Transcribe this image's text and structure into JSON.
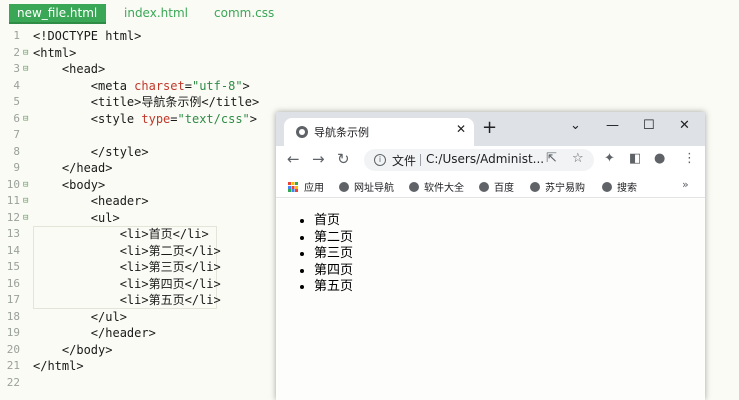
{
  "editor": {
    "tabs": [
      {
        "label": "new_file.html",
        "active": true
      },
      {
        "label": "index.html",
        "active": false
      },
      {
        "label": "comm.css",
        "active": false
      }
    ],
    "accent_color": "#3aa757",
    "lines": [
      {
        "num": "1",
        "fold": "",
        "indent": "",
        "parts": [
          [
            "tag",
            "<!DOCTYPE html>"
          ]
        ]
      },
      {
        "num": "2",
        "fold": "⊟",
        "indent": "",
        "parts": [
          [
            "tag",
            "<html>"
          ]
        ]
      },
      {
        "num": "3",
        "fold": "⊟",
        "indent": "    ",
        "parts": [
          [
            "tag",
            "<head>"
          ]
        ]
      },
      {
        "num": "4",
        "fold": "",
        "indent": "        ",
        "parts": [
          [
            "tag",
            "<meta "
          ],
          [
            "attr",
            "charset"
          ],
          [
            "tag",
            "="
          ],
          [
            "str",
            "\"utf-8\""
          ],
          [
            "tag",
            ">"
          ]
        ]
      },
      {
        "num": "5",
        "fold": "",
        "indent": "        ",
        "parts": [
          [
            "tag",
            "<title>"
          ],
          [
            "plain",
            "导航条示例"
          ],
          [
            "tag",
            "</title>"
          ]
        ]
      },
      {
        "num": "6",
        "fold": "⊟",
        "indent": "        ",
        "parts": [
          [
            "tag",
            "<style "
          ],
          [
            "attr",
            "type"
          ],
          [
            "tag",
            "="
          ],
          [
            "str",
            "\"text/css\""
          ],
          [
            "tag",
            ">"
          ]
        ]
      },
      {
        "num": "7",
        "fold": "",
        "indent": "",
        "parts": []
      },
      {
        "num": "8",
        "fold": "",
        "indent": "        ",
        "parts": [
          [
            "tag",
            "</style>"
          ]
        ]
      },
      {
        "num": "9",
        "fold": "",
        "indent": "    ",
        "parts": [
          [
            "tag",
            "</head>"
          ]
        ]
      },
      {
        "num": "10",
        "fold": "⊟",
        "indent": "    ",
        "parts": [
          [
            "tag",
            "<body>"
          ]
        ]
      },
      {
        "num": "11",
        "fold": "⊟",
        "indent": "        ",
        "parts": [
          [
            "tag",
            "<header>"
          ]
        ]
      },
      {
        "num": "12",
        "fold": "⊟",
        "indent": "        ",
        "parts": [
          [
            "tag",
            "<ul>"
          ]
        ]
      },
      {
        "num": "13",
        "fold": "",
        "indent": "            ",
        "parts": [
          [
            "tag",
            "<li>"
          ],
          [
            "plain",
            "首页"
          ],
          [
            "tag",
            "</li>"
          ]
        ]
      },
      {
        "num": "14",
        "fold": "",
        "indent": "            ",
        "parts": [
          [
            "tag",
            "<li>"
          ],
          [
            "plain",
            "第二页"
          ],
          [
            "tag",
            "</li>"
          ]
        ]
      },
      {
        "num": "15",
        "fold": "",
        "indent": "            ",
        "parts": [
          [
            "tag",
            "<li>"
          ],
          [
            "plain",
            "第三页"
          ],
          [
            "tag",
            "</li>"
          ]
        ]
      },
      {
        "num": "16",
        "fold": "",
        "indent": "            ",
        "parts": [
          [
            "tag",
            "<li>"
          ],
          [
            "plain",
            "第四页"
          ],
          [
            "tag",
            "</li>"
          ]
        ]
      },
      {
        "num": "17",
        "fold": "",
        "indent": "            ",
        "parts": [
          [
            "tag",
            "<li>"
          ],
          [
            "plain",
            "第五页"
          ],
          [
            "tag",
            "</li>"
          ]
        ]
      },
      {
        "num": "18",
        "fold": "",
        "indent": "        ",
        "parts": [
          [
            "tag",
            "</ul>"
          ]
        ]
      },
      {
        "num": "19",
        "fold": "",
        "indent": "        ",
        "parts": [
          [
            "tag",
            "</header>"
          ]
        ]
      },
      {
        "num": "20",
        "fold": "",
        "indent": "    ",
        "parts": [
          [
            "tag",
            "</body>"
          ]
        ]
      },
      {
        "num": "21",
        "fold": "",
        "indent": "",
        "parts": [
          [
            "tag",
            "</html>"
          ]
        ]
      },
      {
        "num": "22",
        "fold": "",
        "indent": "",
        "parts": []
      }
    ]
  },
  "browser": {
    "tab_title": "导航条示例",
    "tab_close": "✕",
    "new_tab": "+",
    "window_controls": {
      "minimize": "—",
      "maximize": "☐",
      "close": "✕",
      "tabs_menu": "⌄"
    },
    "nav": {
      "back": "←",
      "forward": "→",
      "reload": "↻"
    },
    "omnibox": {
      "security_label": "文件",
      "url": "C:/Users/Administ..."
    },
    "toolbar_icons": {
      "share": "⇱",
      "star": "☆",
      "extensions": "✦",
      "side_panel": "◧",
      "profile": "●",
      "menu": "⋮"
    },
    "bookmarks": [
      {
        "label": "应用",
        "icon": "apps-grid-icon"
      },
      {
        "label": "网址导航",
        "icon": "globe-icon"
      },
      {
        "label": "软件大全",
        "icon": "globe-icon"
      },
      {
        "label": "百度",
        "icon": "globe-icon"
      },
      {
        "label": "苏宁易购",
        "icon": "globe-icon"
      },
      {
        "label": "搜索",
        "icon": "globe-icon"
      }
    ],
    "bookmarks_more": "»",
    "page_list": [
      "首页",
      "第二页",
      "第三页",
      "第四页",
      "第五页"
    ]
  }
}
